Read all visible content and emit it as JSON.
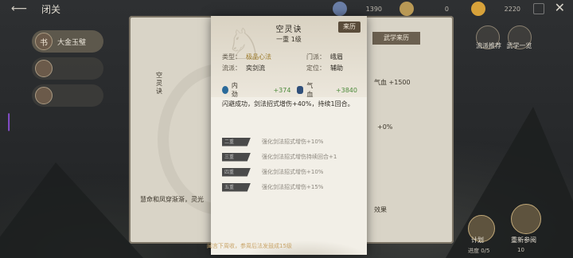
{
  "topbar": {
    "title": "闭关",
    "resources": [
      {
        "icon": "jade-icon",
        "value": "1390",
        "color": "#6b7fa8"
      },
      {
        "icon": "leaf-icon",
        "value": "0",
        "color": "#b99955"
      },
      {
        "icon": "gold-icon",
        "value": "2220",
        "color": "#d8a23a"
      }
    ]
  },
  "sidebar": {
    "items": [
      {
        "label": "大金玉璧",
        "badge": "书"
      },
      {
        "label": "",
        "badge": ""
      },
      {
        "label": "",
        "badge": ""
      }
    ]
  },
  "book": {
    "vertical_label": "空灵诀",
    "footer": "慧命和凤穿渐渐，灵光",
    "right_tab": "武学来历",
    "right_stat": "气血 +1500",
    "right_extra": "效果",
    "right_line": "+0%"
  },
  "card": {
    "title": "空灵诀",
    "level": "一重 1级",
    "source_button": "来历",
    "attributes": {
      "type_label": "类型：",
      "type_value": "极品心法",
      "faction_label": "流派：",
      "faction_value": "奕剑流",
      "sect_label": "门派：",
      "sect_value": "峨眉",
      "position_label": "定位：",
      "position_value": "辅助"
    },
    "stats": [
      {
        "icon": "inner-force-icon",
        "name": "内劲",
        "value": "+374"
      },
      {
        "icon": "vitality-icon",
        "name": "气血",
        "value": "+3840"
      }
    ],
    "description": "闪避成功，剑法招式增伤+40%，持续1回合。",
    "upgrades": [
      {
        "tag": "二重",
        "text": "强化剑法招式增伤+10%"
      },
      {
        "tag": "三重",
        "text": "强化剑法招式增伤持续回合+1"
      },
      {
        "tag": "四重",
        "text": "强化剑法招式增伤+10%"
      },
      {
        "tag": "五重",
        "text": "强化剑法招式增伤+15%"
      }
    ]
  },
  "ticker": "闻言下周收，参周后法发鼓成15级",
  "right_panel": {
    "buttons": [
      "流派推荐",
      "武学一览"
    ]
  },
  "bottom": {
    "plot_label": "计划",
    "plot_progress": "进度 0/5",
    "restart_label": "重新参阅",
    "restart_count": "10"
  },
  "colors": {
    "accent_gold": "#9c7a28",
    "stat_green": "#4c8a3a",
    "source_button_bg": "#5a4c3a"
  }
}
